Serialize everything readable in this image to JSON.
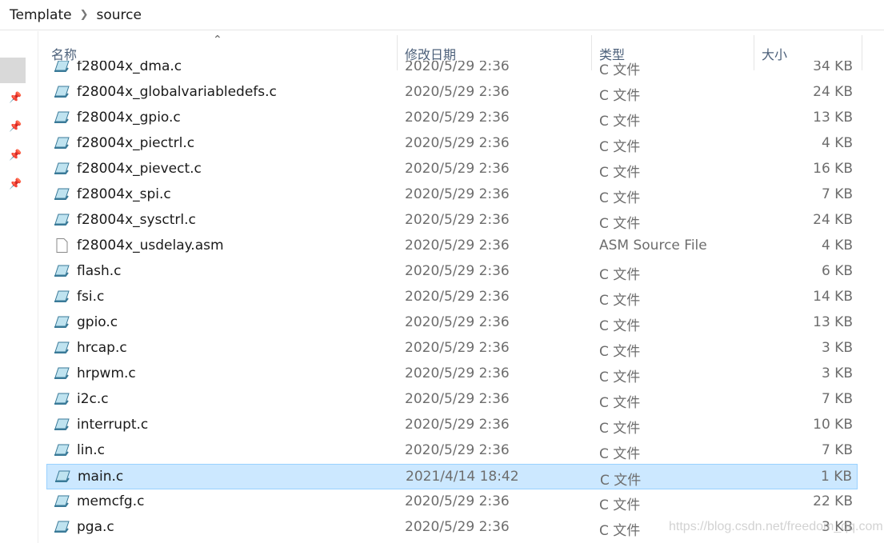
{
  "breadcrumb": [
    "Template",
    "source"
  ],
  "columns": {
    "name": "名称",
    "date": "修改日期",
    "type": "类型",
    "size": "大小"
  },
  "files": [
    {
      "name": "f28004x_dma.c",
      "date": "2020/5/29 2:36",
      "type": "C 文件",
      "size": "34 KB",
      "icon": "c-file-icon"
    },
    {
      "name": "f28004x_globalvariabledefs.c",
      "date": "2020/5/29 2:36",
      "type": "C 文件",
      "size": "24 KB",
      "icon": "c-file-icon"
    },
    {
      "name": "f28004x_gpio.c",
      "date": "2020/5/29 2:36",
      "type": "C 文件",
      "size": "13 KB",
      "icon": "c-file-icon"
    },
    {
      "name": "f28004x_piectrl.c",
      "date": "2020/5/29 2:36",
      "type": "C 文件",
      "size": "4 KB",
      "icon": "c-file-icon"
    },
    {
      "name": "f28004x_pievect.c",
      "date": "2020/5/29 2:36",
      "type": "C 文件",
      "size": "16 KB",
      "icon": "c-file-icon"
    },
    {
      "name": "f28004x_spi.c",
      "date": "2020/5/29 2:36",
      "type": "C 文件",
      "size": "7 KB",
      "icon": "c-file-icon"
    },
    {
      "name": "f28004x_sysctrl.c",
      "date": "2020/5/29 2:36",
      "type": "C 文件",
      "size": "24 KB",
      "icon": "c-file-icon"
    },
    {
      "name": "f28004x_usdelay.asm",
      "date": "2020/5/29 2:36",
      "type": "ASM Source File",
      "size": "4 KB",
      "icon": "blank-file-icon"
    },
    {
      "name": "flash.c",
      "date": "2020/5/29 2:36",
      "type": "C 文件",
      "size": "6 KB",
      "icon": "c-file-icon"
    },
    {
      "name": "fsi.c",
      "date": "2020/5/29 2:36",
      "type": "C 文件",
      "size": "14 KB",
      "icon": "c-file-icon"
    },
    {
      "name": "gpio.c",
      "date": "2020/5/29 2:36",
      "type": "C 文件",
      "size": "13 KB",
      "icon": "c-file-icon"
    },
    {
      "name": "hrcap.c",
      "date": "2020/5/29 2:36",
      "type": "C 文件",
      "size": "3 KB",
      "icon": "c-file-icon"
    },
    {
      "name": "hrpwm.c",
      "date": "2020/5/29 2:36",
      "type": "C 文件",
      "size": "3 KB",
      "icon": "c-file-icon"
    },
    {
      "name": "i2c.c",
      "date": "2020/5/29 2:36",
      "type": "C 文件",
      "size": "7 KB",
      "icon": "c-file-icon"
    },
    {
      "name": "interrupt.c",
      "date": "2020/5/29 2:36",
      "type": "C 文件",
      "size": "10 KB",
      "icon": "c-file-icon"
    },
    {
      "name": "lin.c",
      "date": "2020/5/29 2:36",
      "type": "C 文件",
      "size": "7 KB",
      "icon": "c-file-icon"
    },
    {
      "name": "main.c",
      "date": "2021/4/14 18:42",
      "type": "C 文件",
      "size": "1 KB",
      "icon": "c-file-icon",
      "selected": true
    },
    {
      "name": "memcfg.c",
      "date": "2020/5/29 2:36",
      "type": "C 文件",
      "size": "22 KB",
      "icon": "c-file-icon"
    },
    {
      "name": "pga.c",
      "date": "2020/5/29 2:36",
      "type": "C 文件",
      "size": "3 KB",
      "icon": "c-file-icon"
    }
  ],
  "watermark": "https://blog.csdn.net/freedom_qq.com",
  "colors": {
    "selection": "#cce8ff",
    "selection_border": "#99d1ff",
    "header_text": "#4c607a"
  }
}
